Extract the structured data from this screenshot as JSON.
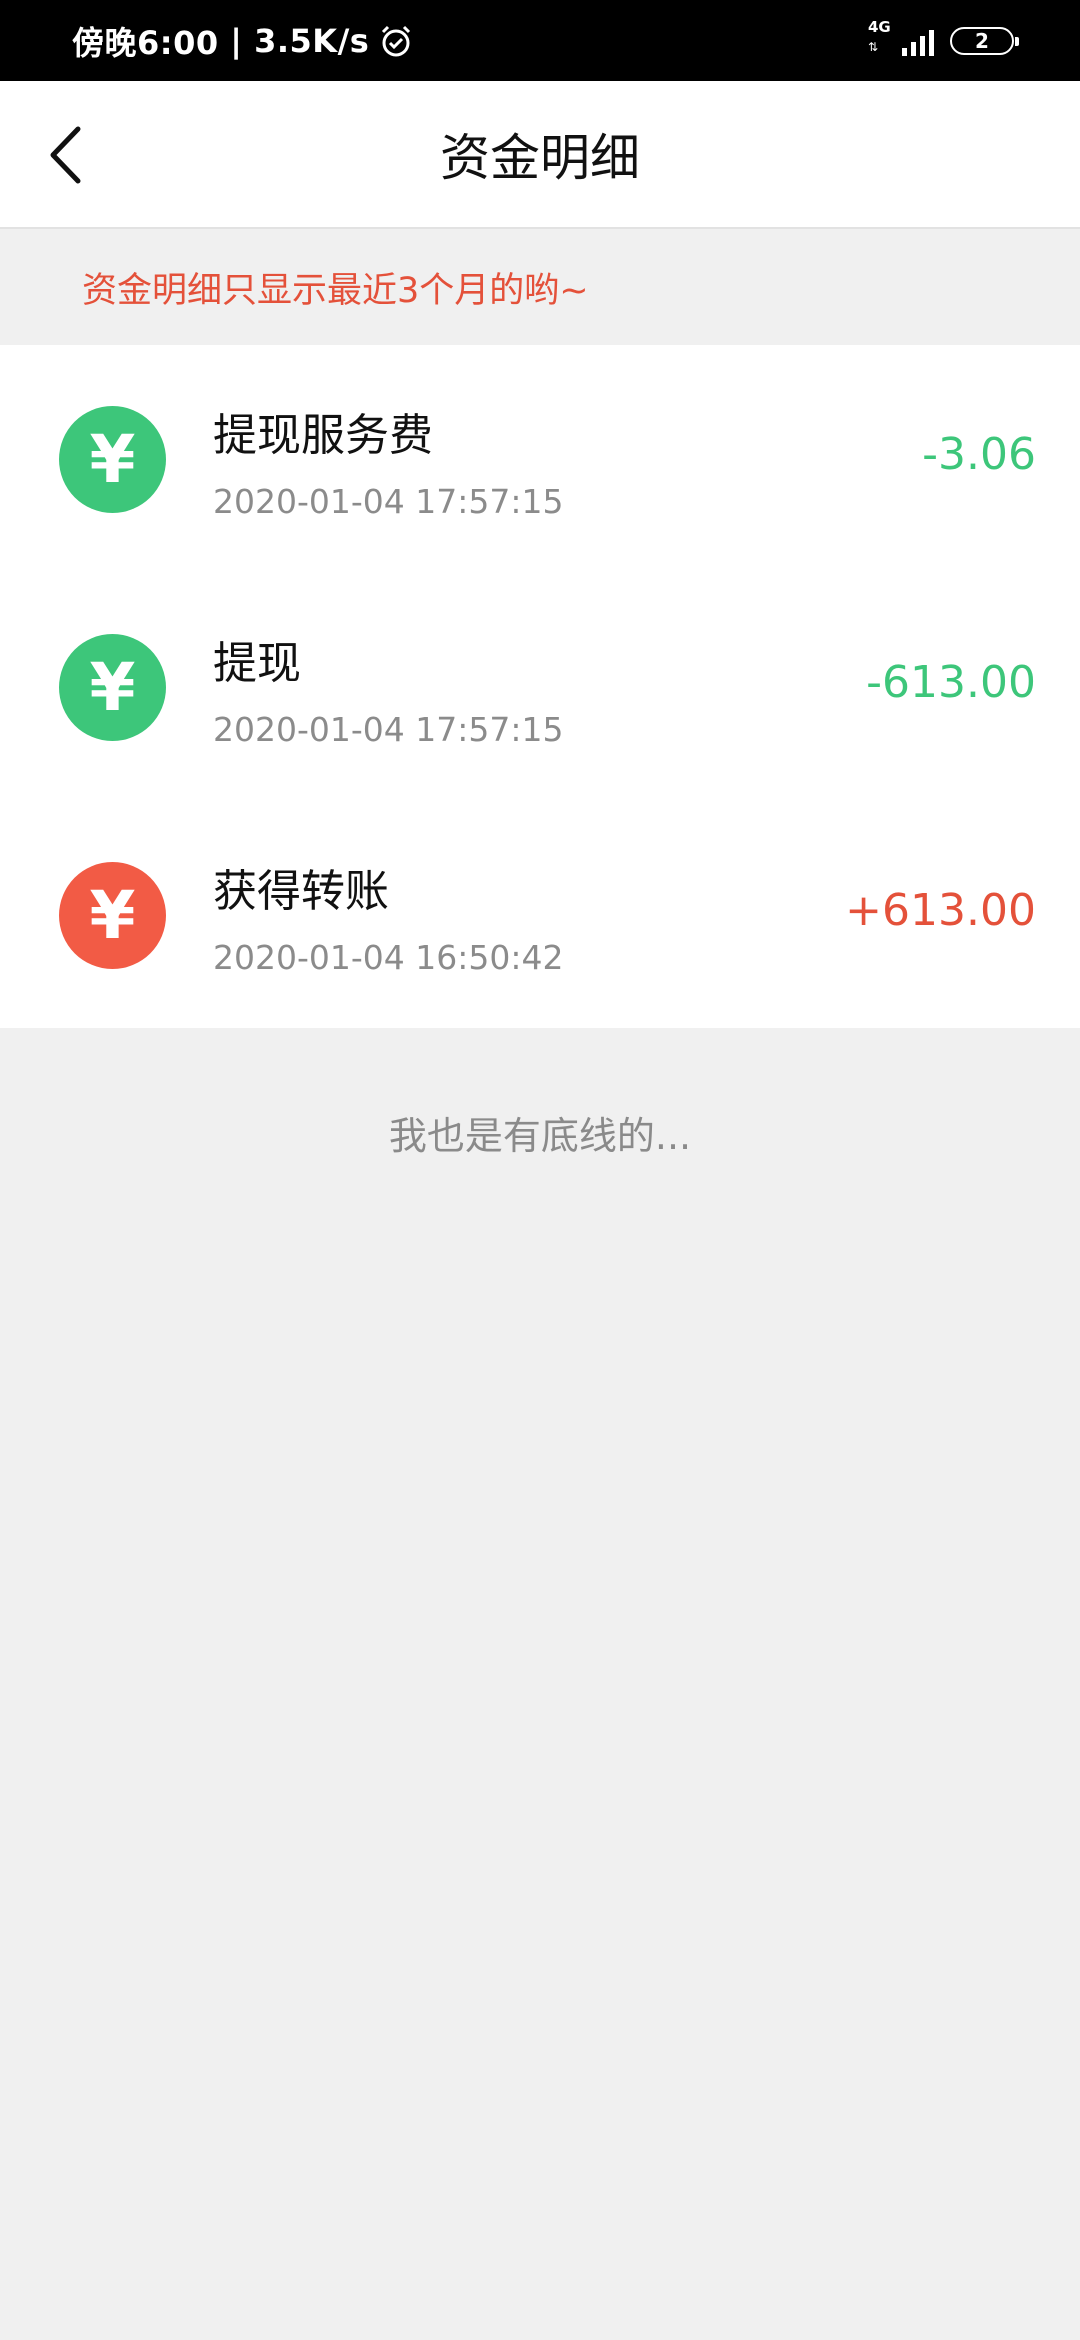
{
  "status_bar": {
    "time": "傍晚6:00",
    "network_speed": "3.5K/s",
    "network_type": "4G",
    "battery": "2",
    "icons": [
      "alarm-icon",
      "signal-icon",
      "battery-icon"
    ]
  },
  "header": {
    "back_icon": "chevron-left-icon",
    "title": "资金明细"
  },
  "notice": {
    "text": "资金明细只显示最近3个月的哟~"
  },
  "transactions": [
    {
      "title": "提现服务费",
      "time": "2020-01-04 17:57:15",
      "amount": "-3.06",
      "icon": "yuan-coin-icon",
      "color": "#3dc67a"
    },
    {
      "title": "提现",
      "time": "2020-01-04 17:57:15",
      "amount": "-613.00",
      "icon": "yuan-coin-icon",
      "color": "#3dc67a"
    },
    {
      "title": "获得转账",
      "time": "2020-01-04 16:50:42",
      "amount": "+613.00",
      "icon": "yuan-coin-icon",
      "color": "#f25b45"
    }
  ],
  "coin_symbol": "¥",
  "footer": {
    "text": "我也是有底线的..."
  },
  "colors": {
    "accent_red": "#e4513a",
    "accent_green": "#3dc67a",
    "background": "#f0f0f0"
  }
}
